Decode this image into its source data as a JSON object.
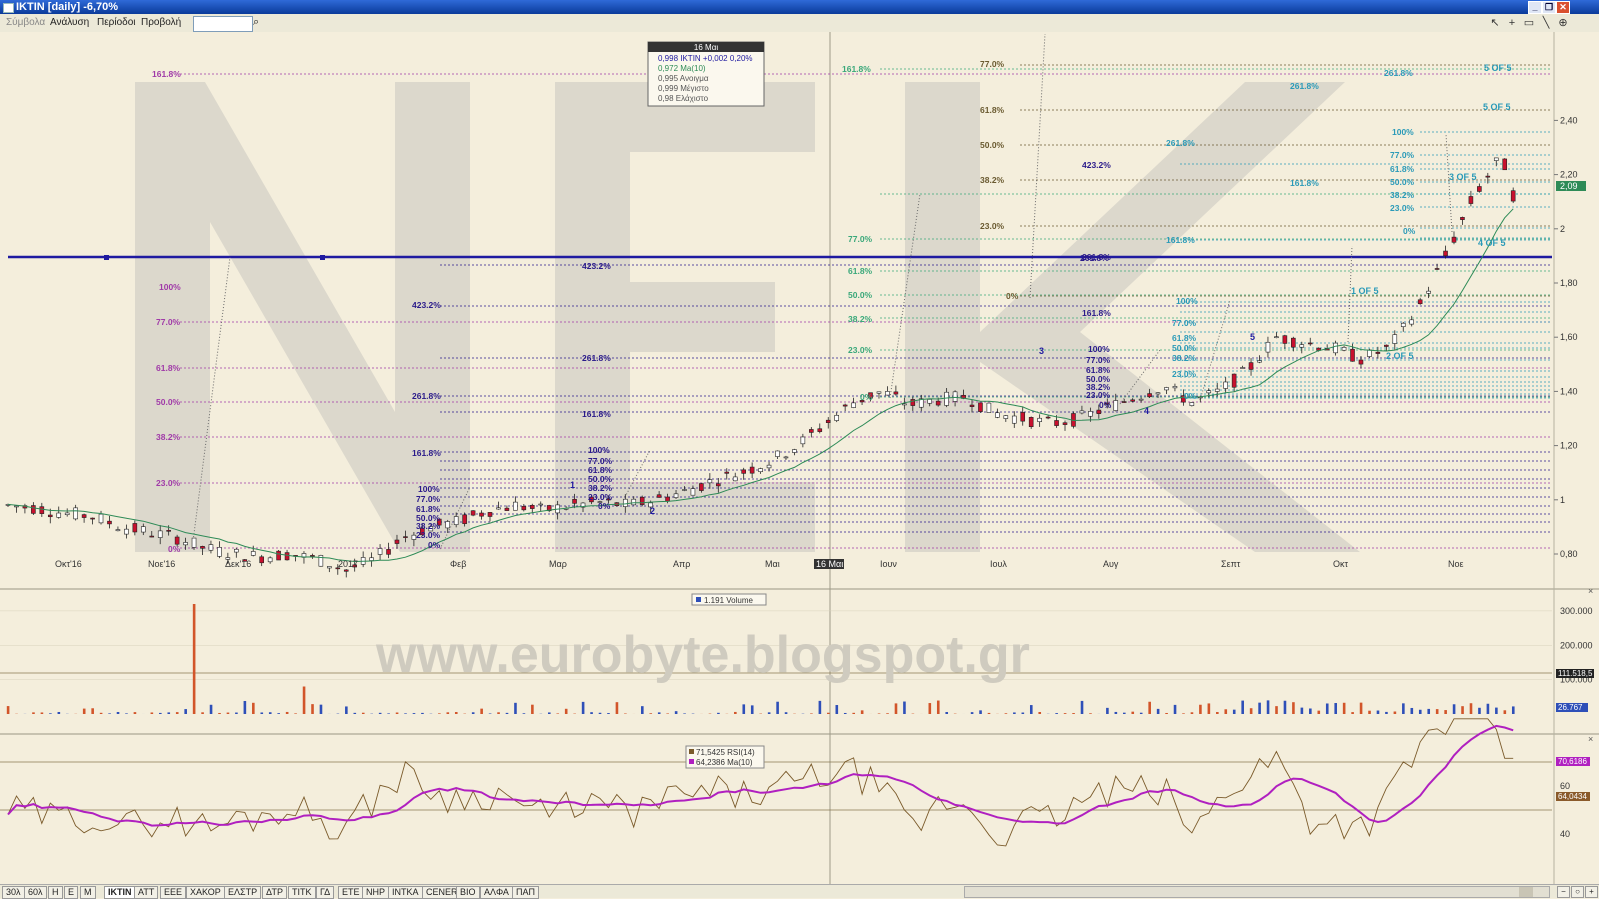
{
  "window": {
    "title": "IKTIN [daily] -6,70%"
  },
  "menu": {
    "items": [
      "Σύμβολα",
      "Ανάλυση",
      "Περίοδοι",
      "Προβολή"
    ],
    "search_value": ""
  },
  "watermarks": {
    "big": "NEK",
    "url": "www.eurobyte.blogspot.gr"
  },
  "tooltip": {
    "date": "16 Μαι",
    "lines": [
      "0,998 IKTIN +0,002 0,20%",
      "0,972 Ma(10)",
      "0,995 Ανοιγμα",
      "0,999 Μέγιστο",
      "0,98 Ελάχιστο"
    ]
  },
  "colors": {
    "background": "#f4eedc",
    "up": "#ffffff",
    "down": "#c8102e",
    "ma": "#2e8b57",
    "rsi": "#7a5a2a",
    "rsi_ma": "#b020c0",
    "vol_up": "#2e4fb8",
    "vol_down": "#d2552a",
    "hline": "#2a1a8a"
  },
  "xaxis_labels": [
    "Οκτ'16",
    "Νοε'16",
    "Δεκ'16",
    "2017",
    "Φεβ",
    "Μαρ",
    "Απρ",
    "Μαι",
    "16 Μαι",
    "Ιουν",
    "Ιουλ",
    "Αυγ",
    "Σεπτ",
    "Οκτ",
    "Νοε"
  ],
  "price_axis_labels": [
    "2,40",
    "2,20",
    "2",
    "1,80",
    "1,60",
    "1,40",
    "1,20",
    "1",
    "0,80"
  ],
  "price_current": "2,09",
  "volume_panel": {
    "legend": "1.191 Volume",
    "axis_labels": [
      "300.000",
      "200.000",
      "100.000"
    ],
    "tags": [
      "111.518,5",
      "26.767"
    ]
  },
  "rsi_panel": {
    "legend": [
      "71,5425 RSI(14)",
      "64,2386 Ma(10)"
    ],
    "axis_labels": [
      "60",
      "40"
    ],
    "tags": [
      "70,6186",
      "64,0434"
    ]
  },
  "fib_labels": [
    "161.8%",
    "100%",
    "77.0%",
    "61.8%",
    "50.0%",
    "38.2%",
    "23.0%",
    "0%",
    "423.2%",
    "261.8%",
    "161.8%",
    "100%",
    "77.0%",
    "61.8%",
    "50.0%",
    "38.2%",
    "23.0%",
    "0%",
    "261.8%",
    "423.2%",
    "161.8%",
    "100%",
    "77.0%",
    "61.8%",
    "50.0%",
    "38.2%",
    "23.0%",
    "0%",
    "77.0%",
    "61.8%",
    "50.0%",
    "38.2%",
    "23.0%",
    "0%",
    "423.2%",
    "261.8%",
    "161.8%",
    "100%",
    "77.0%",
    "61.8%",
    "50.0%",
    "38.2%",
    "23.0%",
    "0%",
    "261.8%",
    "161.8%",
    "100%",
    "77.0%",
    "61.8%",
    "50.0%",
    "38.2%",
    "23.0%",
    "0%",
    "161.8%",
    "261.8%",
    "161.8%",
    "100%",
    "77.0%",
    "61.8%",
    "50.0%",
    "38.2%",
    "23.0%",
    "0%"
  ],
  "wave_labels": [
    "1",
    "2",
    "3",
    "4",
    "5",
    "1 OF 5",
    "2 OF 5",
    "3 OF 5",
    "4 OF 5",
    "5 OF 5"
  ],
  "bottom_tabs": [
    "30λ",
    "60λ",
    "Η",
    "Ε",
    "Μ",
    "IKTIN",
    "ATT",
    "EEE",
    "ΧΑΚΟΡ",
    "ΕΛΣΤΡ",
    "ΔΤΡ",
    "ΤΙΤΚ",
    "ΓΔ",
    "ΕΤΕ",
    "ΝΗΡ",
    "ΙΝΤΚΑ",
    "CENER",
    "ΒΙΟ",
    "ΑΛΦΑ",
    "ΠΑΠ"
  ],
  "chart_data": {
    "type": "candlestick",
    "symbol": "IKTIN",
    "interval": "daily",
    "change_pct": -6.7,
    "last_close": 2.09,
    "ylim": [
      0.7,
      2.5
    ],
    "y_ticks": [
      0.8,
      1.0,
      1.2,
      1.4,
      1.6,
      1.8,
      2.0,
      2.2,
      2.4
    ],
    "x_months": [
      "Οκτ'16",
      "Νοε'16",
      "Δεκ'16",
      "2017",
      "Φεβ",
      "Μαρ",
      "Απρ",
      "Μαι",
      "Ιουν",
      "Ιουλ",
      "Αυγ",
      "Σεπτ",
      "Οκτ",
      "Νοε"
    ],
    "close_path": [
      [
        0,
        0.98
      ],
      [
        10,
        0.97
      ],
      [
        20,
        0.95
      ],
      [
        30,
        0.94
      ],
      [
        40,
        0.9
      ],
      [
        50,
        0.88
      ],
      [
        60,
        0.86
      ],
      [
        70,
        0.82
      ],
      [
        80,
        0.8
      ],
      [
        90,
        0.79
      ],
      [
        100,
        0.8
      ],
      [
        110,
        0.78
      ],
      [
        120,
        0.74
      ],
      [
        130,
        0.78
      ],
      [
        140,
        0.86
      ],
      [
        150,
        0.9
      ],
      [
        160,
        0.92
      ],
      [
        170,
        0.96
      ],
      [
        180,
        0.98
      ],
      [
        190,
        0.96
      ],
      [
        200,
        0.98
      ],
      [
        210,
        0.99
      ],
      [
        220,
        0.98
      ],
      [
        230,
        1.0
      ],
      [
        240,
        1.03
      ],
      [
        250,
        1.07
      ],
      [
        260,
        1.1
      ],
      [
        270,
        1.14
      ],
      [
        280,
        1.2
      ],
      [
        290,
        1.28
      ],
      [
        300,
        1.36
      ],
      [
        310,
        1.4
      ],
      [
        320,
        1.35
      ],
      [
        330,
        1.37
      ],
      [
        340,
        1.38
      ],
      [
        350,
        1.32
      ],
      [
        360,
        1.3
      ],
      [
        370,
        1.28
      ],
      [
        380,
        1.3
      ],
      [
        390,
        1.34
      ],
      [
        400,
        1.38
      ],
      [
        410,
        1.42
      ],
      [
        420,
        1.36
      ],
      [
        430,
        1.4
      ],
      [
        440,
        1.48
      ],
      [
        450,
        1.6
      ],
      [
        460,
        1.58
      ],
      [
        470,
        1.56
      ],
      [
        480,
        1.52
      ],
      [
        490,
        1.56
      ],
      [
        500,
        1.7
      ],
      [
        510,
        1.9
      ],
      [
        520,
        2.12
      ],
      [
        530,
        2.27
      ],
      [
        535,
        2.09
      ]
    ],
    "ma10_label": "Ma(10)",
    "volume": {
      "axis_ticks": [
        100000,
        200000,
        300000
      ],
      "peak": 320000,
      "last": 1191,
      "ma_levels": [
        111518.5,
        26767
      ]
    },
    "rsi14": {
      "last": 71.5425,
      "ma10": 64.2386,
      "axis_ticks": [
        40,
        60
      ],
      "levels": [
        30,
        50,
        70
      ]
    }
  }
}
